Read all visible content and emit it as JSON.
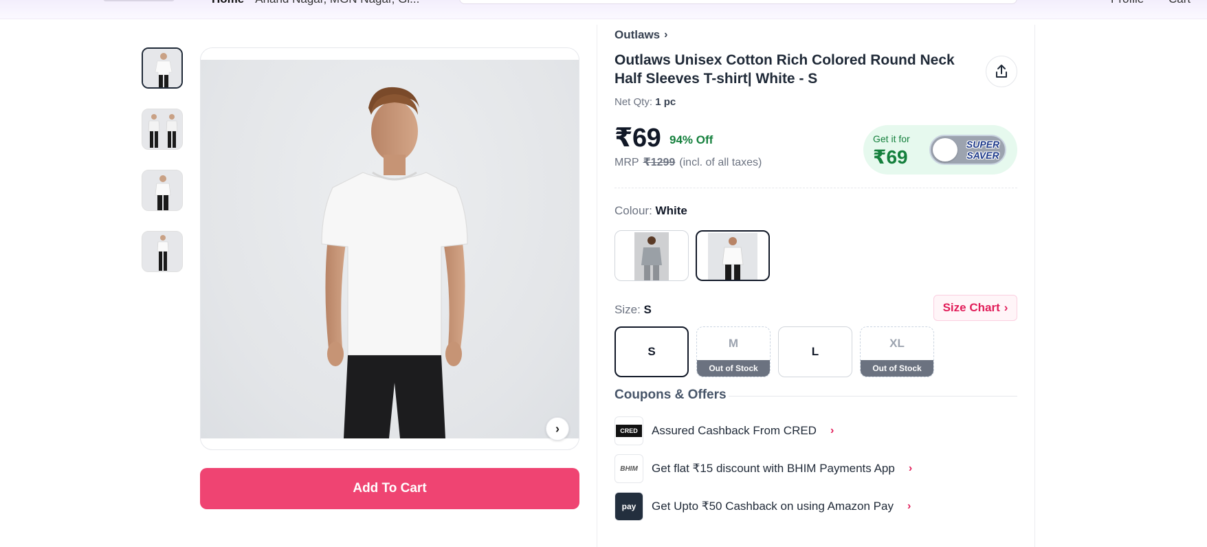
{
  "header": {
    "location_label": "Home",
    "location_text": "Anand Nagar, MGN Nagar, Gi...",
    "nav_profile": "Profile",
    "nav_cart": "Cart"
  },
  "gallery": {
    "thumbnail_count": 4,
    "next_icon": "chevron-right-icon"
  },
  "actions": {
    "add_to_cart": "Add To Cart"
  },
  "product": {
    "brand": "Outlaws",
    "title": "Outlaws Unisex Cotton Rich Colored Round Neck Half Sleeves T-shirt| White - S",
    "net_qty_label": "Net Qty:",
    "net_qty_value": "1 pc",
    "price": "₹69",
    "discount": "94% Off",
    "mrp_label": "MRP",
    "mrp_value": "₹1299",
    "tax_note": "(incl. of all taxes)"
  },
  "super_saver": {
    "get_it_for": "Get it for",
    "price": "₹69",
    "badge_line1": "SUPER",
    "badge_line2": "SAVER"
  },
  "colour": {
    "label": "Colour:",
    "selected": "White",
    "options": [
      "Grey",
      "White"
    ]
  },
  "size": {
    "label": "Size:",
    "selected": "S",
    "size_chart_label": "Size Chart",
    "options": [
      {
        "label": "S",
        "status": ""
      },
      {
        "label": "M",
        "status": "Out of Stock"
      },
      {
        "label": "L",
        "status": ""
      },
      {
        "label": "XL",
        "status": "Out of Stock"
      }
    ]
  },
  "coupons": {
    "heading": "Coupons & Offers",
    "items": [
      {
        "logo": "CRED",
        "text": "Assured Cashback From CRED"
      },
      {
        "logo": "BHIM",
        "text": "Get flat ₹15 discount with BHIM Payments App"
      },
      {
        "logo": "pay",
        "text": "Get Upto ₹50 Cashback on using Amazon Pay"
      }
    ]
  },
  "colors": {
    "accent": "#ef4472",
    "discount_green": "#15803d",
    "size_chart_pink": "#e11d59"
  }
}
